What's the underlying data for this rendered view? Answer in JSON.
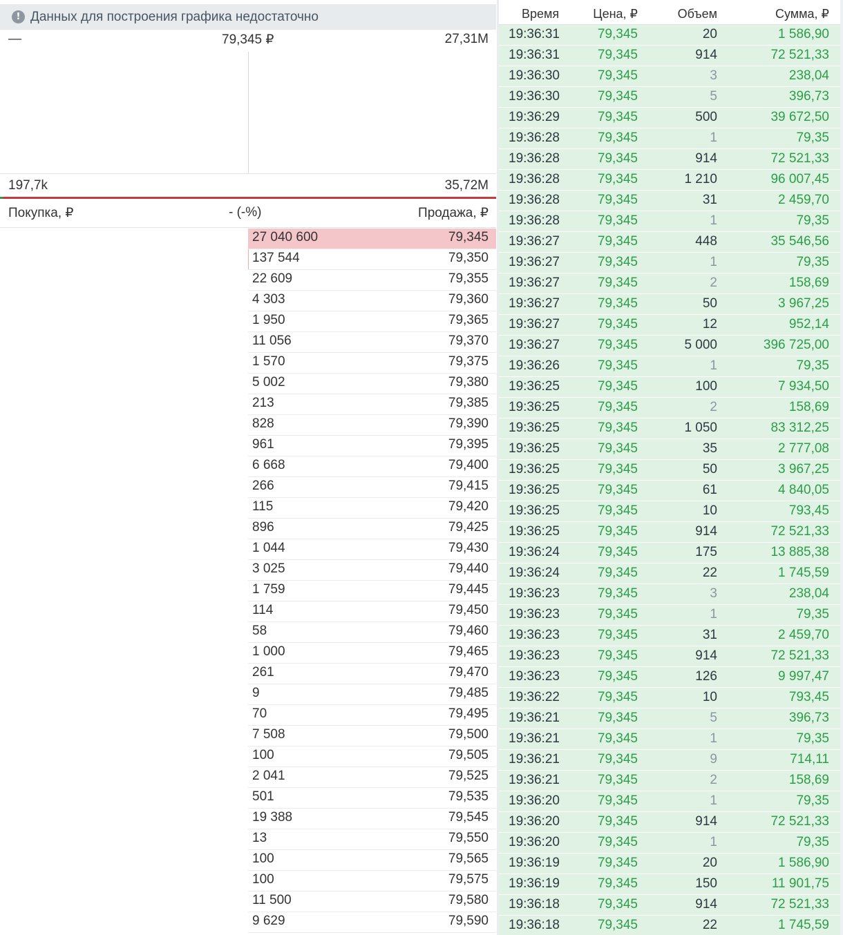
{
  "notice": {
    "icon": "info-icon",
    "text": "Данных для построения графика недостаточно"
  },
  "chart": {
    "top_left": "—",
    "top_center": "79,345 ₽",
    "top_right": "27,31M",
    "bottom_left": "197,7k",
    "bottom_right": "35,72M"
  },
  "orderbook": {
    "buy_label": "Покупка, ₽",
    "change_label": "- (-%)",
    "sell_label": "Продажа, ₽",
    "asks": [
      {
        "vol": "27 040 600",
        "price": "79,345"
      },
      {
        "vol": "137 544",
        "price": "79,350"
      },
      {
        "vol": "22 609",
        "price": "79,355"
      },
      {
        "vol": "4 303",
        "price": "79,360"
      },
      {
        "vol": "1 950",
        "price": "79,365"
      },
      {
        "vol": "11 056",
        "price": "79,370"
      },
      {
        "vol": "1 570",
        "price": "79,375"
      },
      {
        "vol": "5 002",
        "price": "79,380"
      },
      {
        "vol": "213",
        "price": "79,385"
      },
      {
        "vol": "828",
        "price": "79,390"
      },
      {
        "vol": "961",
        "price": "79,395"
      },
      {
        "vol": "6 668",
        "price": "79,400"
      },
      {
        "vol": "266",
        "price": "79,415"
      },
      {
        "vol": "115",
        "price": "79,420"
      },
      {
        "vol": "896",
        "price": "79,425"
      },
      {
        "vol": "1 044",
        "price": "79,430"
      },
      {
        "vol": "3 025",
        "price": "79,440"
      },
      {
        "vol": "1 759",
        "price": "79,445"
      },
      {
        "vol": "114",
        "price": "79,450"
      },
      {
        "vol": "58",
        "price": "79,460"
      },
      {
        "vol": "1 000",
        "price": "79,465"
      },
      {
        "vol": "261",
        "price": "79,470"
      },
      {
        "vol": "9",
        "price": "79,485"
      },
      {
        "vol": "70",
        "price": "79,495"
      },
      {
        "vol": "7 508",
        "price": "79,500"
      },
      {
        "vol": "100",
        "price": "79,505"
      },
      {
        "vol": "2 041",
        "price": "79,525"
      },
      {
        "vol": "501",
        "price": "79,535"
      },
      {
        "vol": "19 388",
        "price": "79,545"
      },
      {
        "vol": "13",
        "price": "79,550"
      },
      {
        "vol": "100",
        "price": "79,565"
      },
      {
        "vol": "100",
        "price": "79,575"
      },
      {
        "vol": "11 500",
        "price": "79,580"
      },
      {
        "vol": "9 629",
        "price": "79,590"
      }
    ]
  },
  "trades": {
    "headers": {
      "time": "Время",
      "price": "Цена, ₽",
      "volume": "Объем",
      "sum": "Сумма, ₽"
    },
    "colors": {
      "price": "#2b9e47",
      "row_bg": "#dff2e4"
    },
    "rows": [
      {
        "t": "19:36:31",
        "p": "79,345",
        "v": "20",
        "s": "1 586,90"
      },
      {
        "t": "19:36:31",
        "p": "79,345",
        "v": "914",
        "s": "72 521,33"
      },
      {
        "t": "19:36:30",
        "p": "79,345",
        "v": "3",
        "s": "238,04"
      },
      {
        "t": "19:36:30",
        "p": "79,345",
        "v": "5",
        "s": "396,73"
      },
      {
        "t": "19:36:29",
        "p": "79,345",
        "v": "500",
        "s": "39 672,50"
      },
      {
        "t": "19:36:28",
        "p": "79,345",
        "v": "1",
        "s": "79,35"
      },
      {
        "t": "19:36:28",
        "p": "79,345",
        "v": "914",
        "s": "72 521,33"
      },
      {
        "t": "19:36:28",
        "p": "79,345",
        "v": "1 210",
        "s": "96 007,45"
      },
      {
        "t": "19:36:28",
        "p": "79,345",
        "v": "31",
        "s": "2 459,70"
      },
      {
        "t": "19:36:28",
        "p": "79,345",
        "v": "1",
        "s": "79,35"
      },
      {
        "t": "19:36:27",
        "p": "79,345",
        "v": "448",
        "s": "35 546,56"
      },
      {
        "t": "19:36:27",
        "p": "79,345",
        "v": "1",
        "s": "79,35"
      },
      {
        "t": "19:36:27",
        "p": "79,345",
        "v": "2",
        "s": "158,69"
      },
      {
        "t": "19:36:27",
        "p": "79,345",
        "v": "50",
        "s": "3 967,25"
      },
      {
        "t": "19:36:27",
        "p": "79,345",
        "v": "12",
        "s": "952,14"
      },
      {
        "t": "19:36:27",
        "p": "79,345",
        "v": "5 000",
        "s": "396 725,00"
      },
      {
        "t": "19:36:26",
        "p": "79,345",
        "v": "1",
        "s": "79,35"
      },
      {
        "t": "19:36:25",
        "p": "79,345",
        "v": "100",
        "s": "7 934,50"
      },
      {
        "t": "19:36:25",
        "p": "79,345",
        "v": "2",
        "s": "158,69"
      },
      {
        "t": "19:36:25",
        "p": "79,345",
        "v": "1 050",
        "s": "83 312,25"
      },
      {
        "t": "19:36:25",
        "p": "79,345",
        "v": "35",
        "s": "2 777,08"
      },
      {
        "t": "19:36:25",
        "p": "79,345",
        "v": "50",
        "s": "3 967,25"
      },
      {
        "t": "19:36:25",
        "p": "79,345",
        "v": "61",
        "s": "4 840,05"
      },
      {
        "t": "19:36:25",
        "p": "79,345",
        "v": "10",
        "s": "793,45"
      },
      {
        "t": "19:36:25",
        "p": "79,345",
        "v": "914",
        "s": "72 521,33"
      },
      {
        "t": "19:36:24",
        "p": "79,345",
        "v": "175",
        "s": "13 885,38"
      },
      {
        "t": "19:36:24",
        "p": "79,345",
        "v": "22",
        "s": "1 745,59"
      },
      {
        "t": "19:36:23",
        "p": "79,345",
        "v": "3",
        "s": "238,04"
      },
      {
        "t": "19:36:23",
        "p": "79,345",
        "v": "1",
        "s": "79,35"
      },
      {
        "t": "19:36:23",
        "p": "79,345",
        "v": "31",
        "s": "2 459,70"
      },
      {
        "t": "19:36:23",
        "p": "79,345",
        "v": "914",
        "s": "72 521,33"
      },
      {
        "t": "19:36:23",
        "p": "79,345",
        "v": "126",
        "s": "9 997,47"
      },
      {
        "t": "19:36:22",
        "p": "79,345",
        "v": "10",
        "s": "793,45"
      },
      {
        "t": "19:36:21",
        "p": "79,345",
        "v": "5",
        "s": "396,73"
      },
      {
        "t": "19:36:21",
        "p": "79,345",
        "v": "1",
        "s": "79,35"
      },
      {
        "t": "19:36:21",
        "p": "79,345",
        "v": "9",
        "s": "714,11"
      },
      {
        "t": "19:36:21",
        "p": "79,345",
        "v": "2",
        "s": "158,69"
      },
      {
        "t": "19:36:20",
        "p": "79,345",
        "v": "1",
        "s": "79,35"
      },
      {
        "t": "19:36:20",
        "p": "79,345",
        "v": "914",
        "s": "72 521,33"
      },
      {
        "t": "19:36:20",
        "p": "79,345",
        "v": "1",
        "s": "79,35"
      },
      {
        "t": "19:36:19",
        "p": "79,345",
        "v": "20",
        "s": "1 586,90"
      },
      {
        "t": "19:36:19",
        "p": "79,345",
        "v": "150",
        "s": "11 901,75"
      },
      {
        "t": "19:36:18",
        "p": "79,345",
        "v": "914",
        "s": "72 521,33"
      },
      {
        "t": "19:36:18",
        "p": "79,345",
        "v": "22",
        "s": "1 745,59"
      }
    ]
  }
}
